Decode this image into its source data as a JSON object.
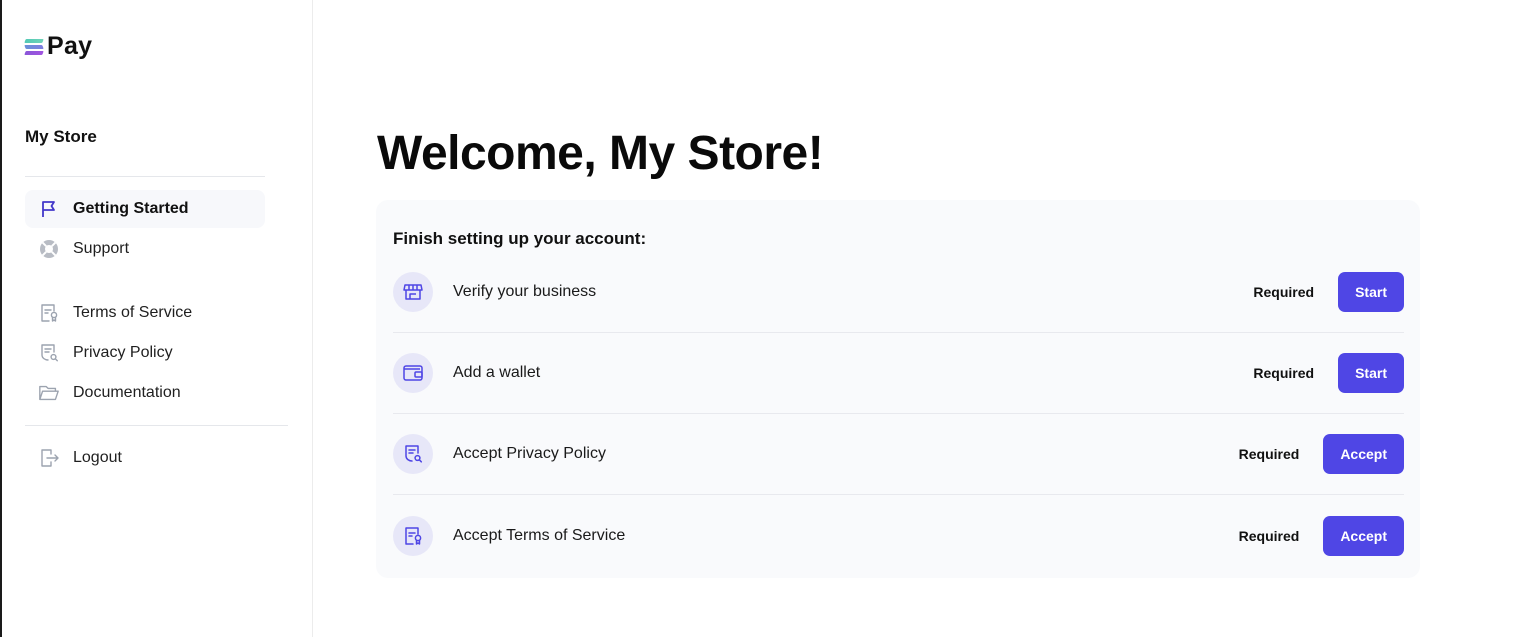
{
  "brand": {
    "name": "Pay",
    "logo_icon": "stacked-stripes-logo-icon"
  },
  "sidebar": {
    "store_name": "My Store",
    "primary_items": [
      {
        "label": "Getting Started",
        "icon": "flag-icon",
        "active": true
      },
      {
        "label": "Support",
        "icon": "lifebuoy-icon",
        "active": false
      }
    ],
    "secondary_items": [
      {
        "label": "Terms of Service",
        "icon": "document-badge-icon"
      },
      {
        "label": "Privacy Policy",
        "icon": "document-search-icon"
      },
      {
        "label": "Documentation",
        "icon": "folder-open-icon"
      }
    ],
    "logout": {
      "label": "Logout",
      "icon": "logout-icon"
    }
  },
  "main": {
    "title": "Welcome, My Store!",
    "setup_card": {
      "title": "Finish setting up your account:",
      "tasks": [
        {
          "label": "Verify your business",
          "icon": "storefront-icon",
          "status": "Required",
          "action": "Start"
        },
        {
          "label": "Add a wallet",
          "icon": "wallet-icon",
          "status": "Required",
          "action": "Start"
        },
        {
          "label": "Accept Privacy Policy",
          "icon": "document-search-icon",
          "status": "Required",
          "action": "Accept"
        },
        {
          "label": "Accept Terms of Service",
          "icon": "document-badge-icon",
          "status": "Required",
          "action": "Accept"
        }
      ]
    }
  },
  "colors": {
    "accent": "#4f46e5",
    "icon_active": "#4338ca",
    "icon_muted": "#9ca3af",
    "icon_circle_bg": "#e7e7f8",
    "card_bg": "#f9fafc"
  }
}
